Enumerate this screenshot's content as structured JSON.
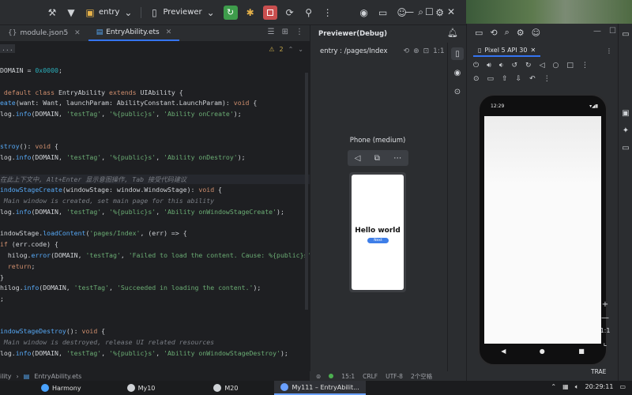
{
  "toolbar": {
    "project": "entry",
    "run_config": "Previewer",
    "minimize": "—",
    "maximize": "☐",
    "close": "✕"
  },
  "editor": {
    "tabs": [
      {
        "label": "module.json5"
      },
      {
        "label": "EntryAbility.ets"
      }
    ],
    "warning_count": "2",
    "collapsed_header": "...",
    "breadcrumb": [
      "ility",
      "EntryAbility.ets"
    ],
    "hint_line": "在此上下文中, Alt+Enter 显示意图操作, Tab 接受代码建议"
  },
  "previewer": {
    "title": "Previewer(Debug)",
    "path": "entry : /pages/Index",
    "ratio": "1:1",
    "device_label": "Phone (medium)",
    "hello_text": "Hello world",
    "next_label": "Next",
    "status": [
      "15:1",
      "CRLF",
      "UTF-8",
      "2个空格"
    ]
  },
  "emulator": {
    "tab": "Pixel 5 API 30",
    "time": "12:29",
    "zoom_plus": "+",
    "zoom_minus": "—",
    "zoom_ratio": "1:1",
    "minimize": "—",
    "maximize": "☐"
  },
  "taskbar": {
    "items": [
      {
        "label": "Harmony"
      },
      {
        "label": "My10"
      },
      {
        "label": "M20"
      },
      {
        "label": "My111 – EntryAbilit..."
      }
    ],
    "tray_label": "TRAE",
    "clock": "20:29:11"
  }
}
